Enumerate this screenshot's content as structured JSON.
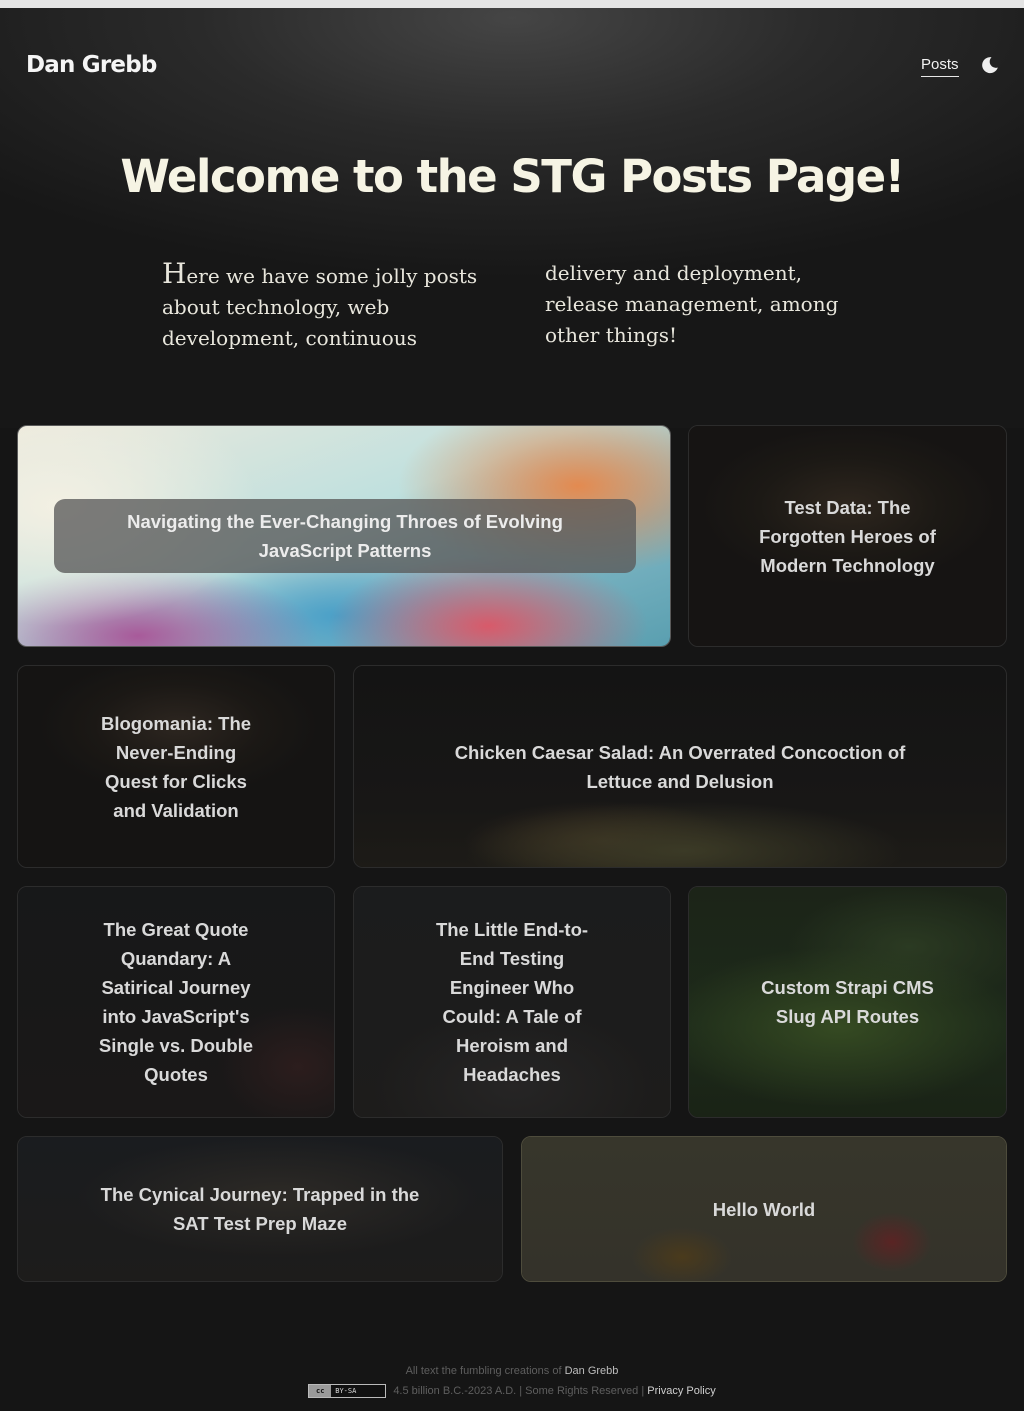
{
  "header": {
    "brand": "Dan Grebb",
    "nav_posts": "Posts",
    "theme_icon": "moon-icon"
  },
  "hero": {
    "title": "Welcome to the STG Posts Page!",
    "intro": "Here we have some jolly posts about technology, web development, continuous delivery and deployment, release management, among other things!"
  },
  "posts": [
    {
      "title": "Navigating the Ever-Changing Throes of Evolving JavaScript Patterns"
    },
    {
      "title": "Test Data: The Forgotten Heroes of Modern Technology"
    },
    {
      "title": "Blogomania: The Never-Ending Quest for Clicks and Validation"
    },
    {
      "title": "Chicken Caesar Salad: An Overrated Concoction of Lettuce and Delusion"
    },
    {
      "title": "The Great Quote Quandary: A Satirical Journey into JavaScript's Single vs. Double Quotes"
    },
    {
      "title": "The Little End-to-End Testing Engineer Who Could: A Tale of Heroism and Headaches"
    },
    {
      "title": "Custom Strapi CMS Slug API Routes"
    },
    {
      "title": "The Cynical Journey: Trapped in the SAT Test Prep Maze"
    },
    {
      "title": "Hello World"
    }
  ],
  "footer": {
    "line1_prefix": "All text the fumbling creations of",
    "author": "Dan Grebb",
    "license_badge": "BY-SA",
    "license_badge_cc": "cc",
    "line2_text": "4.5 billion B.C.-2023 A.D. | Some Rights Reserved |",
    "privacy": "Privacy Policy"
  }
}
